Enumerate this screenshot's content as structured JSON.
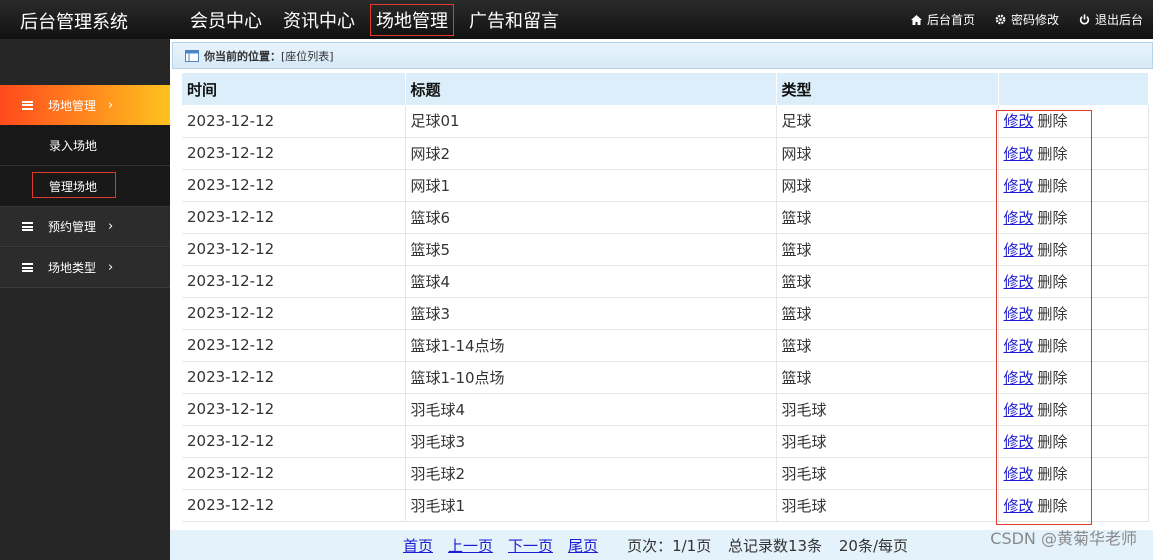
{
  "header": {
    "app_title": "后台管理系统",
    "nav": [
      "会员中心",
      "资讯中心",
      "场地管理",
      "广告和留言"
    ],
    "right_links": [
      {
        "icon": "home-icon",
        "label": "后台首页"
      },
      {
        "icon": "gear-icon",
        "label": "密码修改"
      },
      {
        "icon": "power-icon",
        "label": "退出后台"
      }
    ]
  },
  "sidebar": {
    "groups": [
      {
        "label": "场地管理",
        "chevron": "›"
      },
      {
        "label": "预约管理",
        "chevron": "›"
      },
      {
        "label": "场地类型",
        "chevron": "›"
      }
    ],
    "subs": [
      "录入场地",
      "管理场地"
    ]
  },
  "breadcrumb": {
    "label": "你当前的位置：",
    "value": "[座位列表]"
  },
  "table": {
    "headers": [
      "时间",
      "标题",
      "类型",
      ""
    ],
    "edit_label": "修改",
    "delete_label": "删除",
    "rows": [
      {
        "time": "2023-12-12",
        "title": "足球01",
        "type": "足球"
      },
      {
        "time": "2023-12-12",
        "title": "网球2",
        "type": "网球"
      },
      {
        "time": "2023-12-12",
        "title": "网球1",
        "type": "网球"
      },
      {
        "time": "2023-12-12",
        "title": "篮球6",
        "type": "篮球"
      },
      {
        "time": "2023-12-12",
        "title": "篮球5",
        "type": "篮球"
      },
      {
        "time": "2023-12-12",
        "title": "篮球4",
        "type": "篮球"
      },
      {
        "time": "2023-12-12",
        "title": "篮球3",
        "type": "篮球"
      },
      {
        "time": "2023-12-12",
        "title": "篮球1-14点场",
        "type": "篮球"
      },
      {
        "time": "2023-12-12",
        "title": "篮球1-10点场",
        "type": "篮球"
      },
      {
        "time": "2023-12-12",
        "title": "羽毛球4",
        "type": "羽毛球"
      },
      {
        "time": "2023-12-12",
        "title": "羽毛球3",
        "type": "羽毛球"
      },
      {
        "time": "2023-12-12",
        "title": "羽毛球2",
        "type": "羽毛球"
      },
      {
        "time": "2023-12-12",
        "title": "羽毛球1",
        "type": "羽毛球"
      }
    ]
  },
  "pager": {
    "links": [
      "首页",
      "上一页",
      "下一页",
      "尾页"
    ],
    "page_info": "页次：1/1页",
    "total": "总记录数13条",
    "per_page": "20条/每页"
  },
  "watermark": "CSDN @黄菊华老师",
  "colors": {
    "active_gradient_start": "#ff4a1c",
    "active_gradient_end": "#ffc21f",
    "highlight_border": "#e03a2f",
    "link": "#1c1cd0"
  }
}
